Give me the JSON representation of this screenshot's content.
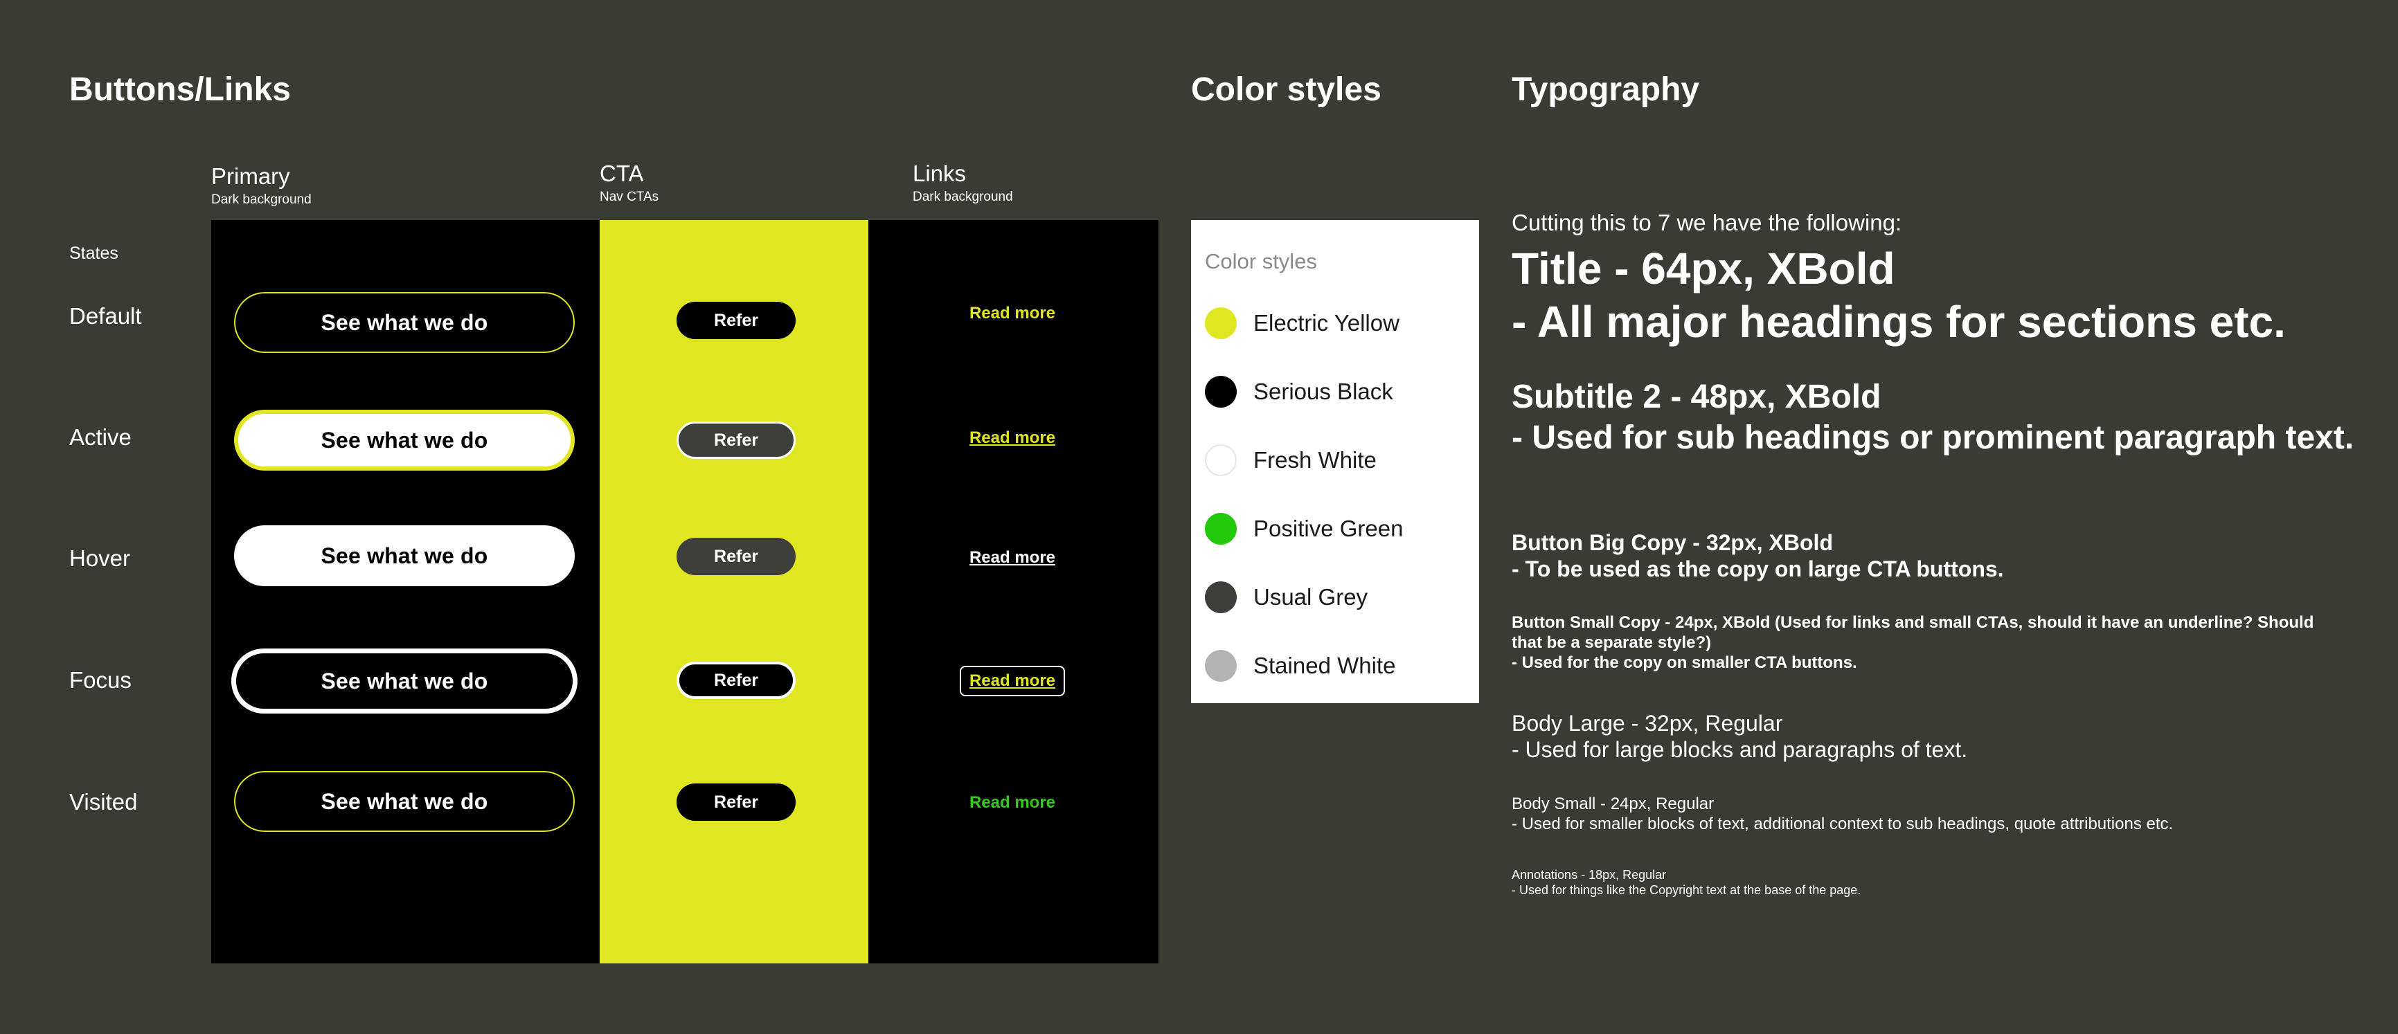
{
  "sections": {
    "buttons_links": "Buttons/Links",
    "color_styles": "Color styles",
    "typography": "Typography"
  },
  "columns": {
    "primary": {
      "title": "Primary",
      "subtitle": "Dark background"
    },
    "cta": {
      "title": "CTA",
      "subtitle": "Nav CTAs"
    },
    "links": {
      "title": "Links",
      "subtitle": "Dark background"
    }
  },
  "states": {
    "heading": "States",
    "default": "Default",
    "active": "Active",
    "hover": "Hover",
    "focus": "Focus",
    "visited": "Visited"
  },
  "labels": {
    "primary_button": "See what we do",
    "cta_button": "Refer",
    "link": "Read more"
  },
  "colors": {
    "title": "Color styles",
    "items": [
      {
        "name": "Electric Yellow",
        "hex": "#e1e622"
      },
      {
        "name": "Serious Black",
        "hex": "#000000"
      },
      {
        "name": "Fresh White",
        "hex": "#ffffff"
      },
      {
        "name": "Positive Green",
        "hex": "#22c80a"
      },
      {
        "name": "Usual Grey",
        "hex": "#3e3e3a"
      },
      {
        "name": "Stained White",
        "hex": "#b3b3b3"
      }
    ]
  },
  "typography": {
    "intro": "Cutting this to 7 we have the following:",
    "title_line1": "Title - 64px, XBold",
    "title_line2": "- All major headings for sections etc.",
    "subtitle_line1": "Subtitle 2 - 48px, XBold",
    "subtitle_line2": "- Used for sub headings or prominent paragraph text.",
    "bbig_line1": "Button Big Copy - 32px, XBold",
    "bbig_line2": "- To be used as the copy on large CTA buttons.",
    "bsmall_line1": "Button Small Copy - 24px, XBold (Used for links and small CTAs, should it have an underline? Should that be a separate style?)",
    "bsmall_line2": "- Used for the copy on smaller CTA buttons.",
    "blarge_line1": "Body Large - 32px, Regular",
    "blarge_line2": "- Used for large blocks and paragraphs of text.",
    "bsm_line1": "Body Small - 24px, Regular",
    "bsm_line2": "- Used for smaller blocks of text, additional context to sub headings, quote attributions etc.",
    "annot_line1": "Annotations - 18px, Regular",
    "annot_line2": "- Used for things like the Copyright text at the base of the page."
  }
}
